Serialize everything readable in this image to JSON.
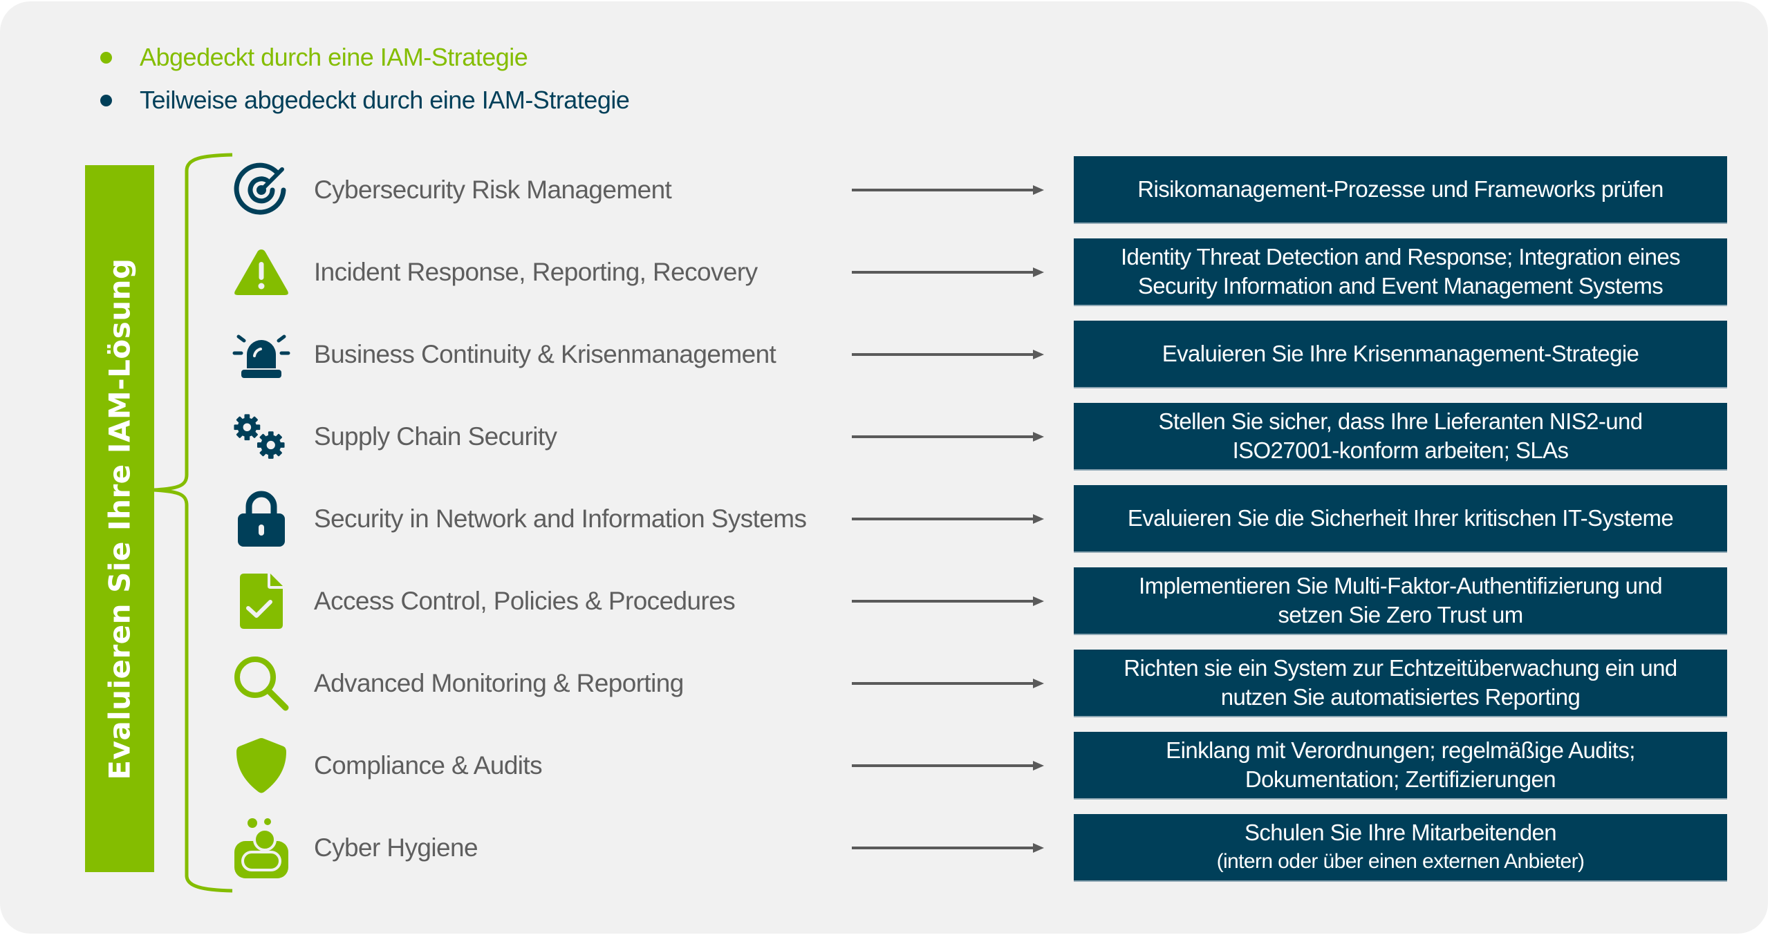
{
  "colors": {
    "green": "#84bd00",
    "navy": "#003f59",
    "label_gray": "#5e5e5e",
    "arrow_gray": "#5a5a5a",
    "panel_bg": "#f1f1f1"
  },
  "legend": [
    {
      "text": "Abgedeckt durch eine IAM-Strategie",
      "color": "#84bd00"
    },
    {
      "text": "Teilweise abgedeckt durch eine IAM-Strategie",
      "color": "#003f59"
    }
  ],
  "side_label": "Evaluieren Sie Ihre IAM-Lösung",
  "rows": [
    {
      "label": "Cybersecurity Risk Management",
      "icon": "target-icon",
      "icon_color": "navy",
      "action": [
        "Risikomanagement-Prozesse und Frameworks prüfen"
      ]
    },
    {
      "label": "Incident Response, Reporting, Recovery",
      "icon": "warning-triangle-icon",
      "icon_color": "green",
      "action": [
        "Identity Threat Detection and Response; Integration eines",
        "Security Information and Event Management Systems"
      ]
    },
    {
      "label": "Business Continuity & Krisenmanagement",
      "icon": "alarm-siren-icon",
      "icon_color": "navy",
      "action": [
        "Evaluieren Sie Ihre Krisenmanagement-Strategie"
      ]
    },
    {
      "label": "Supply Chain Security",
      "icon": "gears-icon",
      "icon_color": "navy",
      "action": [
        "Stellen Sie sicher, dass Ihre Lieferanten NIS2-und",
        "ISO27001-konform arbeiten; SLAs"
      ]
    },
    {
      "label": "Security in Network and Information Systems",
      "icon": "padlock-icon",
      "icon_color": "navy",
      "action": [
        "Evaluieren Sie die Sicherheit Ihrer kritischen IT-Systeme"
      ]
    },
    {
      "label": "Access Control, Policies & Procedures",
      "icon": "document-check-icon",
      "icon_color": "green",
      "action": [
        "Implementieren Sie Multi-Faktor-Authentifizierung und",
        "setzen Sie Zero Trust um"
      ]
    },
    {
      "label": "Advanced Monitoring & Reporting",
      "icon": "magnifier-icon",
      "icon_color": "green",
      "action": [
        "Richten sie ein System zur Echtzeitüberwachung ein und",
        "nutzen Sie automatisiertes Reporting"
      ]
    },
    {
      "label": "Compliance & Audits",
      "icon": "shield-icon",
      "icon_color": "green",
      "action": [
        "Einklang mit Verordnungen; regelmäßige Audits;",
        "Dokumentation; Zertifizierungen"
      ]
    },
    {
      "label": "Cyber Hygiene",
      "icon": "soap-icon",
      "icon_color": "green",
      "action": [
        "Schulen Sie Ihre Mitarbeitenden",
        "(intern oder über einen externen Anbieter)"
      ]
    }
  ]
}
